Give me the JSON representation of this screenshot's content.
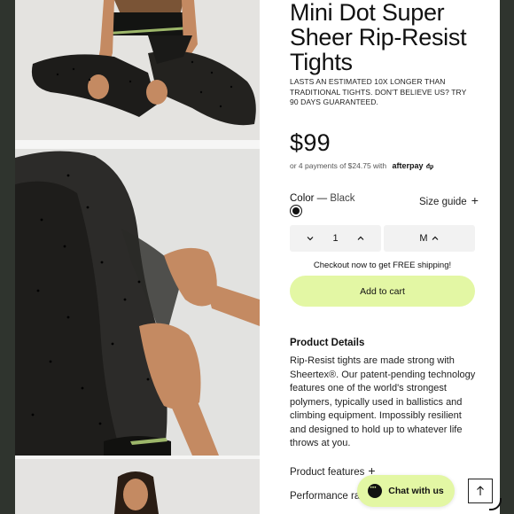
{
  "product": {
    "title": "Mini Dot Super Sheer Rip-Resist Tights",
    "tagline": "LASTS AN ESTIMATED 10X LONGER THAN TRADITIONAL TIGHTS. DON'T BELIEVE US? TRY 90 DAYS GUARANTEED.",
    "price": "$99",
    "installments": "or 4 payments of $24.75 with",
    "afterpay": "afterpay",
    "color_label": "Color —",
    "color_value": "Black",
    "size_guide": "Size guide",
    "plus": "+",
    "swatch_color": "#111111"
  },
  "selectors": {
    "quantity": "1",
    "size": "M"
  },
  "checkout": {
    "shipping_note": "Checkout now to get FREE shipping!",
    "add_to_cart": "Add to cart"
  },
  "details": {
    "heading": "Product Details",
    "body": "Rip-Resist tights are made strong with Sheertex®. Our patent-pending technology features one of the world's strongest polymers, typically used in ballistics and climbing equipment. Impossibly resilient and designed to hold up to whatever life throws at you.",
    "accordions": [
      {
        "label": "Product features"
      },
      {
        "label": "Performance rati"
      }
    ]
  },
  "widgets": {
    "chat_label": "Chat with us",
    "accent": "#e3f7a4"
  }
}
